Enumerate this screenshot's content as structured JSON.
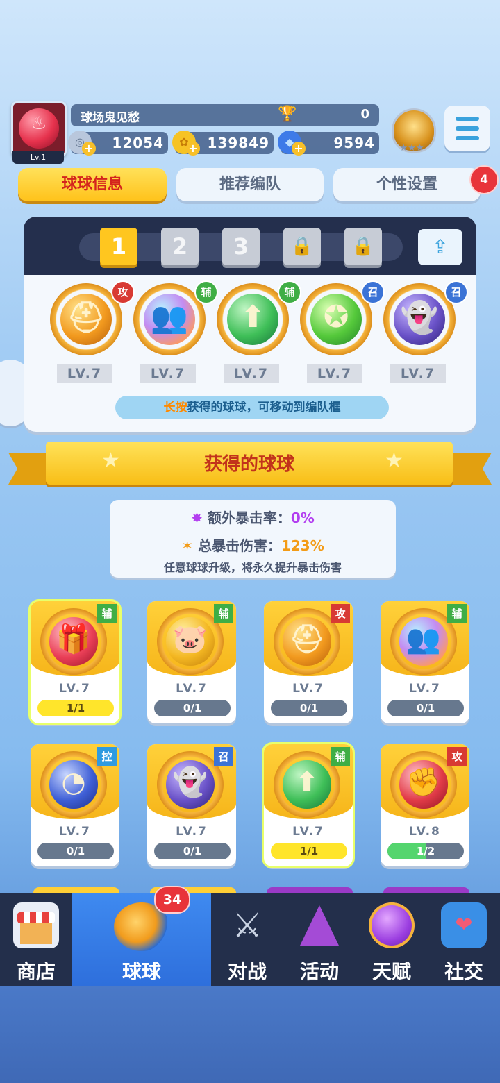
{
  "player": {
    "level_label": "Lv.1",
    "name": "球场鬼见愁",
    "trophies": "0",
    "silver": "12054",
    "gold": "139849",
    "gems": "9594"
  },
  "tabs": [
    {
      "label": "球球信息"
    },
    {
      "label": "推荐编队"
    },
    {
      "label": "个性设置",
      "badge": "4"
    }
  ],
  "team": {
    "slots": [
      "1",
      "2",
      "3"
    ],
    "balls": [
      {
        "icon": "knight-helmet-icon",
        "tag": "攻",
        "level": "LV.7",
        "color": "#f7a92a"
      },
      {
        "icon": "people-icon",
        "tag": "辅",
        "level": "LV.7",
        "color": "#c98cf0"
      },
      {
        "icon": "arrow-up-icon",
        "tag": "辅",
        "level": "LV.7",
        "color": "#3fbf58"
      },
      {
        "icon": "star-shield-icon",
        "tag": "召",
        "level": "LV.7",
        "color": "#55c93b"
      },
      {
        "icon": "ghost-icon",
        "tag": "召",
        "level": "LV.7",
        "color": "#6a52c8"
      }
    ],
    "hint_highlight": "长按",
    "hint_rest": "获得的球球，可移动到编队框"
  },
  "collection": {
    "title": "获得的球球",
    "crit_rate_label": "额外暴击率：",
    "crit_rate_value": "0%",
    "crit_damage_label": "总暴击伤害：",
    "crit_damage_value": "123%",
    "crit_note": "任意球球升级，将永久提升暴击伤害",
    "cards": [
      {
        "icon": "gift-icon",
        "tag": "辅",
        "level": "LV.7",
        "progress": "1/1",
        "full": true
      },
      {
        "icon": "piggy-bank-icon",
        "tag": "辅",
        "level": "LV.7",
        "progress": "0/1",
        "full": false
      },
      {
        "icon": "knight-helmet-icon",
        "tag": "攻",
        "level": "LV.7",
        "progress": "0/1",
        "full": false
      },
      {
        "icon": "people-icon",
        "tag": "辅",
        "level": "LV.7",
        "progress": "0/1",
        "full": false
      },
      {
        "icon": "clock-icon",
        "tag": "控",
        "level": "LV.7",
        "progress": "0/1",
        "full": false
      },
      {
        "icon": "ghost-icon",
        "tag": "召",
        "level": "LV.7",
        "progress": "0/1",
        "full": false
      },
      {
        "icon": "arrow-up-icon",
        "tag": "辅",
        "level": "LV.7",
        "progress": "1/1",
        "full": true
      },
      {
        "icon": "fist-icon",
        "tag": "攻",
        "level": "LV.8",
        "progress": "1/2",
        "full": false,
        "fraction": 0.5
      }
    ]
  },
  "nav": {
    "items": [
      {
        "label": "商店",
        "icon": "shop-icon"
      },
      {
        "label": "球球",
        "icon": "balls-icon",
        "badge": "34"
      },
      {
        "label": "对战",
        "icon": "crossed-swords-icon"
      },
      {
        "label": "活动",
        "icon": "party-popper-icon"
      },
      {
        "label": "天赋",
        "icon": "planet-icon"
      },
      {
        "label": "社交",
        "icon": "heart-phone-icon"
      }
    ]
  },
  "tag_colors": {
    "攻": "#d83a33",
    "辅": "#3fae45",
    "召": "#3b73d6",
    "控": "#2f9be0"
  }
}
